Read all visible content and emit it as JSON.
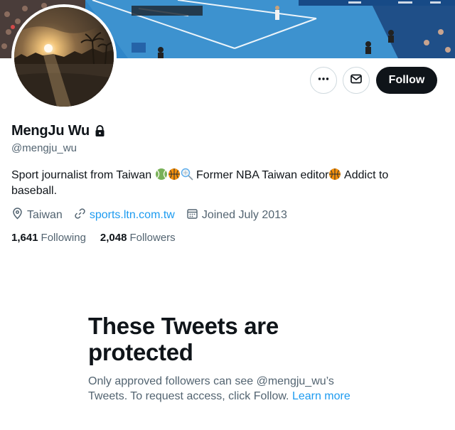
{
  "profile": {
    "display_name": "MengJu Wu",
    "handle": "@mengju_wu",
    "protected": true,
    "bio_start": "Sport journalist from Taiwan",
    "bio_mid": "Former NBA Taiwan editor",
    "bio_end": "Addict to baseball.",
    "bio_emojis_1": [
      "tennis-ball",
      "basketball",
      "badminton"
    ],
    "bio_emojis_2": [
      "basketball"
    ],
    "location": "Taiwan",
    "website": "sports.ltn.com.tw",
    "joined": "Joined July 2013",
    "following_count": "1,641",
    "following_label": "Following",
    "followers_count": "2,048",
    "followers_label": "Followers"
  },
  "actions": {
    "more_icon": "more-horizontal-icon",
    "message_icon": "envelope-icon",
    "follow_label": "Follow"
  },
  "protected_notice": {
    "title": "These Tweets are protected",
    "body": "Only approved followers can see @mengju_wu’s Tweets. To request access, click Follow.",
    "link": "Learn more"
  },
  "colors": {
    "text_primary": "#0f1419",
    "text_secondary": "#536471",
    "link": "#1d9bf0",
    "follow_bg": "#0f1419",
    "border": "#cfd9de"
  }
}
